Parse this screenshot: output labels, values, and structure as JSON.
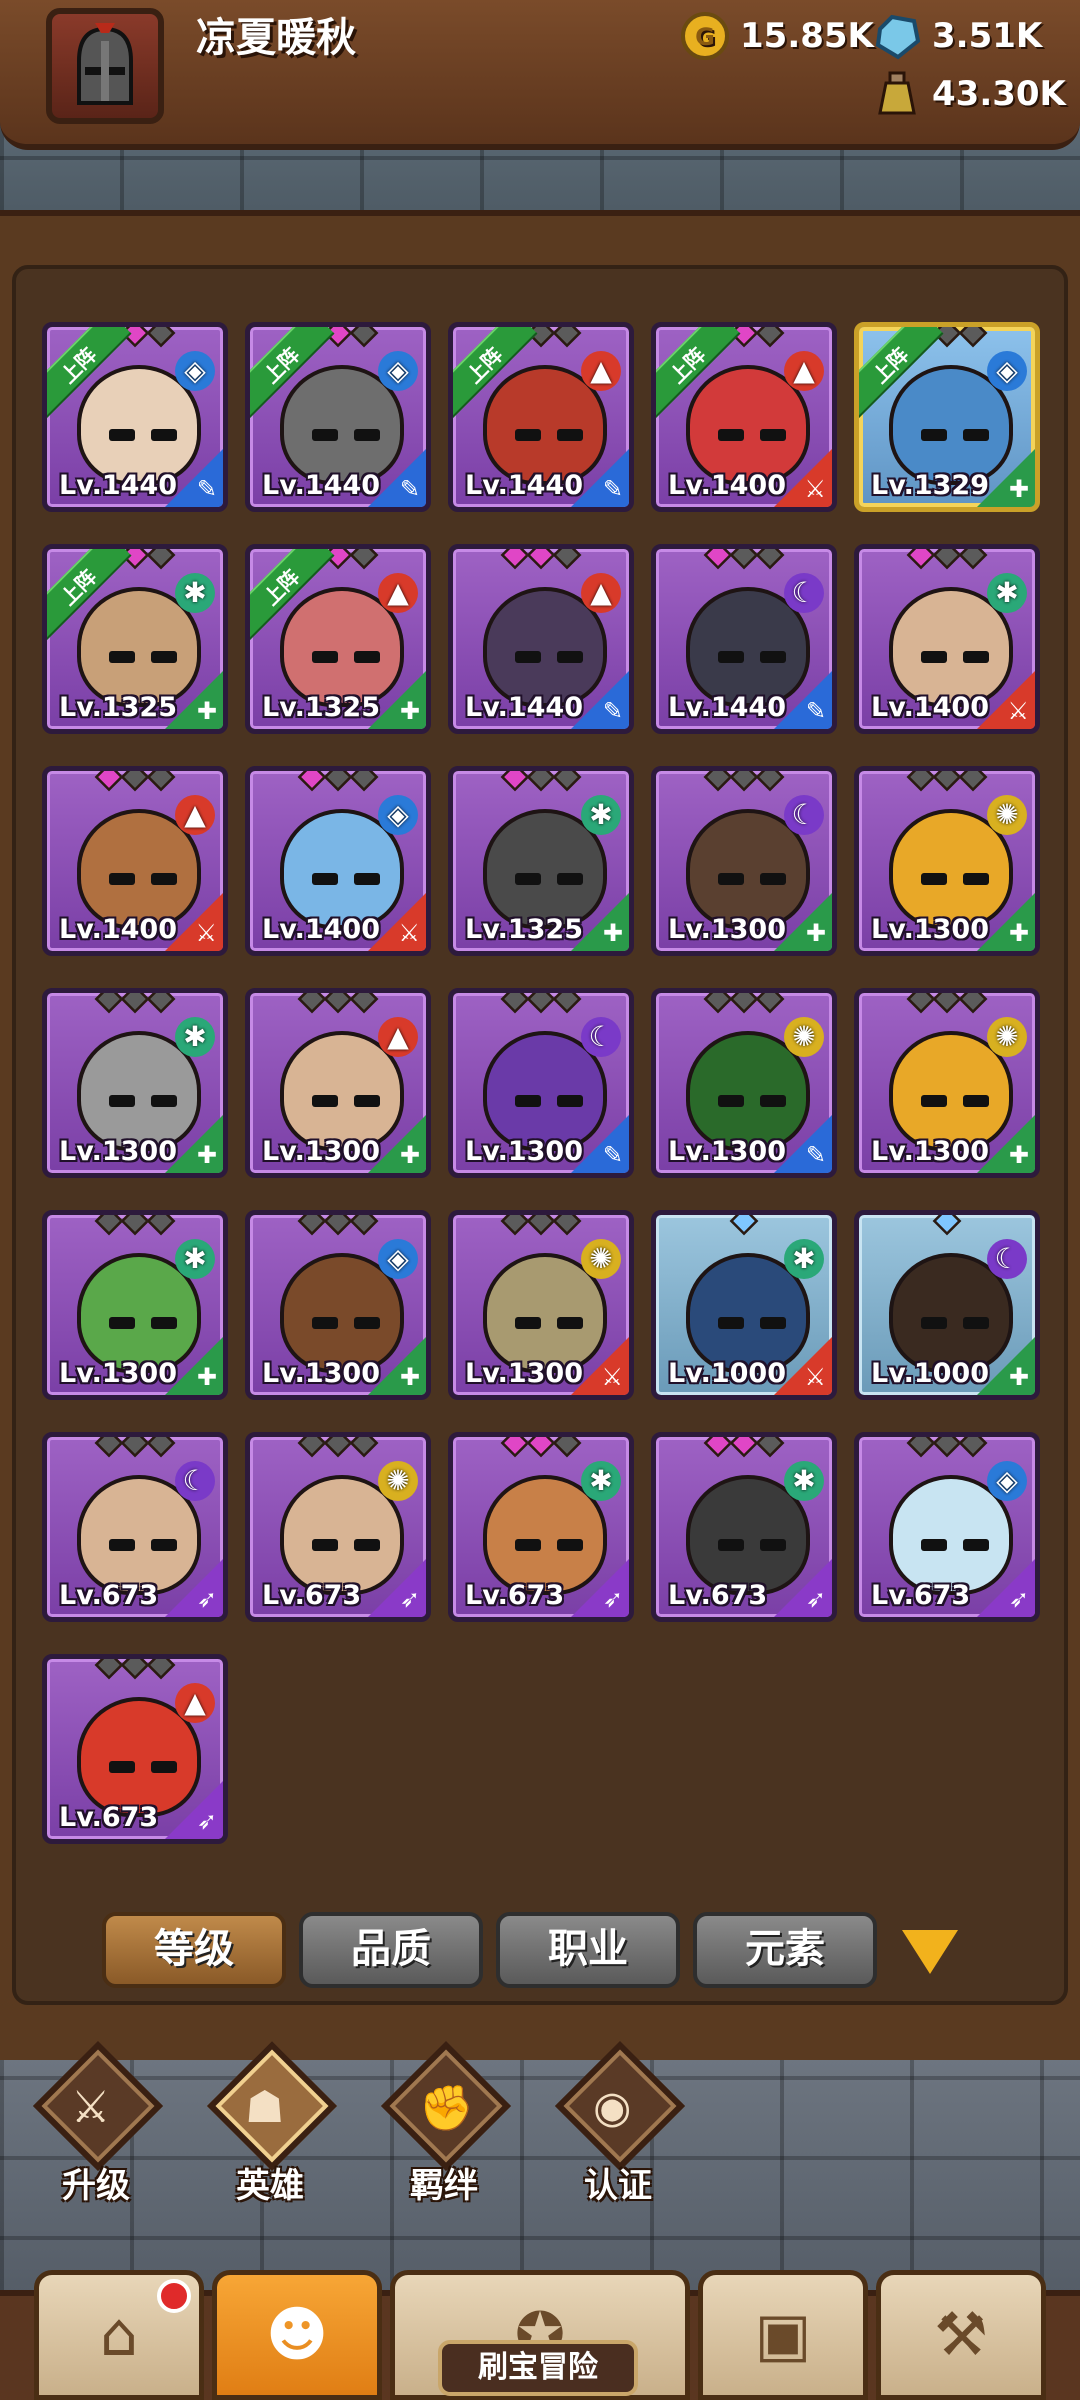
{
  "player": {
    "name": "凉夏暖秋"
  },
  "resources": {
    "gold": "15.85K",
    "gems": "3.51K",
    "potions": "43.30K"
  },
  "deployed_label": "上阵",
  "heroes": [
    {
      "level": "Lv.1440",
      "element": "water",
      "job": "mage",
      "deployed": true,
      "rarity": "purple",
      "stars": [
        "pink",
        "pink",
        "gray"
      ],
      "skin": "#e8d0b8"
    },
    {
      "level": "Lv.1440",
      "element": "water",
      "job": "mage",
      "deployed": true,
      "rarity": "purple",
      "stars": [
        "pink",
        "pink",
        "gray"
      ],
      "skin": "#6e6e6e"
    },
    {
      "level": "Lv.1440",
      "element": "fire",
      "job": "mage",
      "deployed": true,
      "rarity": "purple",
      "stars": [
        "pink",
        "gray",
        "gray"
      ],
      "skin": "#b83a2a"
    },
    {
      "level": "Lv.1400",
      "element": "fire",
      "job": "warrior",
      "deployed": true,
      "rarity": "purple",
      "stars": [
        "pink",
        "pink",
        "gray"
      ],
      "skin": "#d23a3a"
    },
    {
      "level": "Lv.1329",
      "element": "water",
      "job": "tank",
      "deployed": true,
      "rarity": "gold",
      "stars": [
        "gray",
        "gray",
        "gray"
      ],
      "skin": "#4a8ac8"
    },
    {
      "level": "Lv.1325",
      "element": "wind",
      "job": "tank",
      "deployed": true,
      "rarity": "purple",
      "stars": [
        "pink",
        "pink",
        "gray"
      ],
      "skin": "#c8a078"
    },
    {
      "level": "Lv.1325",
      "element": "fire",
      "job": "tank",
      "deployed": true,
      "rarity": "purple",
      "stars": [
        "pink",
        "pink",
        "gray"
      ],
      "skin": "#d07070"
    },
    {
      "level": "Lv.1440",
      "element": "fire",
      "job": "mage",
      "deployed": false,
      "rarity": "purple",
      "stars": [
        "pink",
        "pink",
        "gray"
      ],
      "skin": "#4a3a5a"
    },
    {
      "level": "Lv.1440",
      "element": "dark",
      "job": "mage",
      "deployed": false,
      "rarity": "purple",
      "stars": [
        "pink",
        "gray",
        "gray"
      ],
      "skin": "#3a3a4a"
    },
    {
      "level": "Lv.1400",
      "element": "wind",
      "job": "warrior",
      "deployed": false,
      "rarity": "purple",
      "stars": [
        "pink",
        "gray",
        "gray"
      ],
      "skin": "#d8b494"
    },
    {
      "level": "Lv.1400",
      "element": "fire",
      "job": "warrior",
      "deployed": false,
      "rarity": "purple",
      "stars": [
        "pink",
        "gray",
        "gray"
      ],
      "skin": "#b07040"
    },
    {
      "level": "Lv.1400",
      "element": "water",
      "job": "warrior",
      "deployed": false,
      "rarity": "purple",
      "stars": [
        "pink",
        "gray",
        "gray"
      ],
      "skin": "#7ab6e6"
    },
    {
      "level": "Lv.1325",
      "element": "wind",
      "job": "tank",
      "deployed": false,
      "rarity": "purple",
      "stars": [
        "pink",
        "gray",
        "gray"
      ],
      "skin": "#4a4a4a"
    },
    {
      "level": "Lv.1300",
      "element": "dark",
      "job": "tank",
      "deployed": false,
      "rarity": "purple",
      "stars": [
        "gray",
        "gray",
        "gray"
      ],
      "skin": "#5a4030"
    },
    {
      "level": "Lv.1300",
      "element": "light",
      "job": "tank",
      "deployed": false,
      "rarity": "purple",
      "stars": [
        "gray",
        "gray",
        "gray"
      ],
      "skin": "#e8a828"
    },
    {
      "level": "Lv.1300",
      "element": "wind",
      "job": "tank",
      "deployed": false,
      "rarity": "purple",
      "stars": [
        "gray",
        "gray",
        "gray"
      ],
      "skin": "#9a9a9a"
    },
    {
      "level": "Lv.1300",
      "element": "fire",
      "job": "tank",
      "deployed": false,
      "rarity": "purple",
      "stars": [
        "gray",
        "gray",
        "gray"
      ],
      "skin": "#d8b494"
    },
    {
      "level": "Lv.1300",
      "element": "dark",
      "job": "mage",
      "deployed": false,
      "rarity": "purple",
      "stars": [
        "gray",
        "gray",
        "gray"
      ],
      "skin": "#6a3aa8"
    },
    {
      "level": "Lv.1300",
      "element": "light",
      "job": "mage",
      "deployed": false,
      "rarity": "purple",
      "stars": [
        "gray",
        "gray",
        "gray"
      ],
      "skin": "#2a6a2a"
    },
    {
      "level": "Lv.1300",
      "element": "light",
      "job": "tank",
      "deployed": false,
      "rarity": "purple",
      "stars": [
        "gray",
        "gray",
        "gray"
      ],
      "skin": "#e8a828"
    },
    {
      "level": "Lv.1300",
      "element": "wind",
      "job": "tank",
      "deployed": false,
      "rarity": "purple",
      "stars": [
        "gray",
        "gray",
        "gray"
      ],
      "skin": "#5aa84a"
    },
    {
      "level": "Lv.1300",
      "element": "water",
      "job": "tank",
      "deployed": false,
      "rarity": "purple",
      "stars": [
        "gray",
        "gray",
        "gray"
      ],
      "skin": "#7a4a2a"
    },
    {
      "level": "Lv.1300",
      "element": "light",
      "job": "warrior",
      "deployed": false,
      "rarity": "purple",
      "stars": [
        "gray",
        "gray",
        "gray"
      ],
      "skin": "#a89a70"
    },
    {
      "level": "Lv.1000",
      "element": "wind",
      "job": "warrior",
      "deployed": false,
      "rarity": "blue",
      "stars": [
        "blue"
      ],
      "skin": "#2a4a7a"
    },
    {
      "level": "Lv.1000",
      "element": "dark",
      "job": "tank",
      "deployed": false,
      "rarity": "blue",
      "stars": [
        "blue"
      ],
      "skin": "#3a2a20"
    },
    {
      "level": "Lv.673",
      "element": "dark",
      "job": "archer",
      "deployed": false,
      "rarity": "purple",
      "stars": [
        "gray",
        "gray",
        "gray"
      ],
      "skin": "#d8b494"
    },
    {
      "level": "Lv.673",
      "element": "light",
      "job": "archer",
      "deployed": false,
      "rarity": "purple",
      "stars": [
        "gray",
        "gray",
        "gray"
      ],
      "skin": "#d8b494"
    },
    {
      "level": "Lv.673",
      "element": "wind",
      "job": "archer",
      "deployed": false,
      "rarity": "purple",
      "stars": [
        "pink",
        "pink",
        "gray"
      ],
      "skin": "#c88048"
    },
    {
      "level": "Lv.673",
      "element": "wind",
      "job": "archer",
      "deployed": false,
      "rarity": "purple",
      "stars": [
        "pink",
        "pink",
        "gray"
      ],
      "skin": "#3a3a3a"
    },
    {
      "level": "Lv.673",
      "element": "water",
      "job": "archer",
      "deployed": false,
      "rarity": "purple",
      "stars": [
        "gray",
        "gray",
        "gray"
      ],
      "skin": "#c8e4f2"
    },
    {
      "level": "Lv.673",
      "element": "fire",
      "job": "archer",
      "deployed": false,
      "rarity": "purple",
      "stars": [
        "gray",
        "gray",
        "gray"
      ],
      "skin": "#d83a2a"
    }
  ],
  "element_colors": {
    "water": "#2a7ad8",
    "fire": "#d83a2a",
    "wind": "#2aa878",
    "dark": "#7a3ac8",
    "light": "#d8b020"
  },
  "job_colors": {
    "mage": "#2a6ad8",
    "warrior": "#d83a2a",
    "tank": "#2a9a4a",
    "archer": "#8a3ac8"
  },
  "sort_tabs": [
    "等级",
    "品质",
    "职业",
    "元素"
  ],
  "feature_buttons": [
    "升级",
    "英雄",
    "羁绊",
    "认证"
  ],
  "bottom_nav": {
    "adventure_label": "刷宝冒险"
  }
}
